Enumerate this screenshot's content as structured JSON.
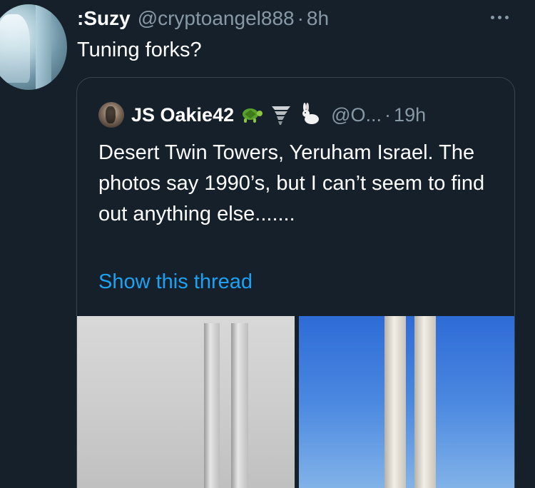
{
  "tweet": {
    "author_name": ":Suzy",
    "handle": "@cryptoangel888",
    "separator": "·",
    "time": "8h",
    "text": "Tuning forks?"
  },
  "quoted_tweet": {
    "author_name": "JS Oakie42",
    "emojis": [
      "turtle-icon",
      "tornado-icon",
      "rabbit-icon"
    ],
    "handle": "@O...",
    "separator": "·",
    "time": "19h",
    "text": "Desert Twin Towers, Yeruham Israel. The photos say 1990’s, but I can’t seem to find out anything else.......",
    "show_thread_label": "Show this thread",
    "photos": [
      "black-and-white towers photo",
      "color towers photo"
    ]
  },
  "colors": {
    "background": "#15202b",
    "secondary_text": "#8899a6",
    "link": "#1da1f2",
    "border": "#38444d"
  }
}
